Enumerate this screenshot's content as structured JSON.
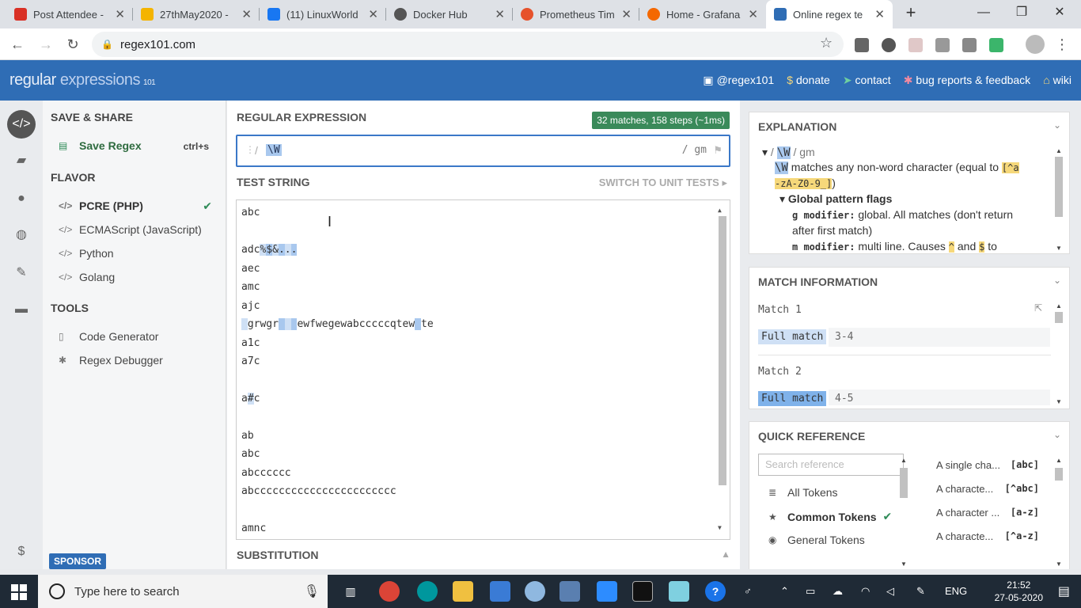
{
  "browser": {
    "tabs": [
      {
        "title": "Post Attendee -",
        "color": "#d93025"
      },
      {
        "title": "27thMay2020 -",
        "color": "#f4b400"
      },
      {
        "title": "(11) LinuxWorld",
        "color": "#1877f2"
      },
      {
        "title": "Docker Hub",
        "color": "#555555"
      },
      {
        "title": "Prometheus Tim",
        "color": "#e6522c"
      },
      {
        "title": "Home - Grafana",
        "color": "#f46800"
      },
      {
        "title": "Online regex te",
        "color": "#2f6db5"
      }
    ],
    "url": "regex101.com"
  },
  "header": {
    "logo_regular": "regular",
    "logo_expressions": "expressions",
    "logo_101": "101",
    "nav": [
      "@regex101",
      "donate",
      "contact",
      "bug reports & feedback",
      "wiki"
    ]
  },
  "left": {
    "save_share": "SAVE & SHARE",
    "save_regex": "Save Regex",
    "save_shortcut": "ctrl+s",
    "flavor": "FLAVOR",
    "flavors": [
      "PCRE (PHP)",
      "ECMAScript (JavaScript)",
      "Python",
      "Golang"
    ],
    "tools": "TOOLS",
    "tool_items": [
      "Code Generator",
      "Regex Debugger"
    ],
    "sponsor": "SPONSOR"
  },
  "center": {
    "regex_label": "REGULAR EXPRESSION",
    "match_badge": "32 matches, 158 steps (~1ms)",
    "regex_value": "\\W",
    "flags": "/ gm",
    "test_label": "TEST STRING",
    "switch_label": "SWITCH TO UNIT TESTS",
    "lines": [
      "abc",
      "",
      "adc%$&...",
      "aec",
      "amc",
      "ajc",
      " grwgr   ewfwegewabcccccqtew te",
      "a1c",
      "a7c",
      "",
      "a#c",
      "",
      "ab",
      "abc",
      "abcccccc",
      "abccccccccccccccccccccccc",
      "",
      "amnc"
    ],
    "substitution": "SUBSTITUTION"
  },
  "explanation": {
    "title": "EXPLANATION",
    "regex_line_token": "\\W",
    "regex_line_flags": "/ gm",
    "desc_token": "\\W",
    "desc_text": " matches any non-word character (equal to ",
    "desc_class_1": "[^a",
    "desc_class_2": "-zA-Z0-9_]",
    "global_flags": "Global pattern flags",
    "g_mod": "g modifier:",
    "g_text": " global. All matches (don't return",
    "g_text2": "after first match)",
    "m_mod": "m modifier:",
    "m_text": " multi line. Causes ",
    "m_caret": "^",
    "m_and": " and ",
    "m_dollar": "$",
    "m_to": " to"
  },
  "match_info": {
    "title": "MATCH INFORMATION",
    "matches": [
      {
        "label": "Match 1",
        "full": "Full match",
        "range": "3-4"
      },
      {
        "label": "Match 2",
        "full": "Full match",
        "range": "4-5"
      }
    ]
  },
  "quick_ref": {
    "title": "QUICK REFERENCE",
    "search_placeholder": "Search reference",
    "categories": [
      "All Tokens",
      "Common Tokens",
      "General Tokens"
    ],
    "refs": [
      {
        "label": "A single cha...",
        "code": "[abc]"
      },
      {
        "label": "A characte...",
        "code": "[^abc]"
      },
      {
        "label": "A character ...",
        "code": "[a-z]"
      },
      {
        "label": "A characte...",
        "code": "[^a-z]"
      }
    ]
  },
  "taskbar": {
    "search_placeholder": "Type here to search",
    "lang": "ENG",
    "time": "21:52",
    "date": "27-05-2020"
  }
}
